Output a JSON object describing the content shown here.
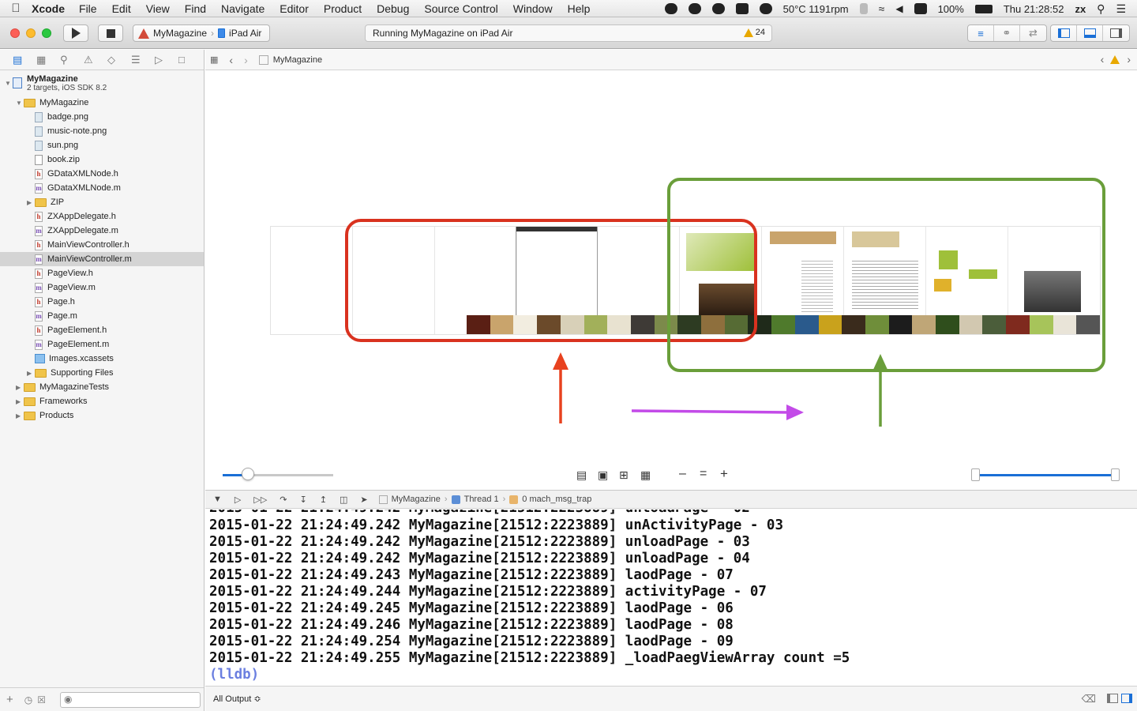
{
  "menubar": {
    "app_name": "Xcode",
    "menus": [
      "File",
      "Edit",
      "View",
      "Find",
      "Navigate",
      "Editor",
      "Product",
      "Debug",
      "Source Control",
      "Window",
      "Help"
    ],
    "cpu_status": "50°C 1191rpm",
    "battery": "100%",
    "clock": "Thu 21:28:52",
    "user": "zx"
  },
  "toolbar": {
    "scheme": "MyMagazine",
    "destination": "iPad Air",
    "activity_text": "Running MyMagazine on iPad Air",
    "warning_count": "24"
  },
  "navigator": {
    "project_name": "MyMagazine",
    "project_subtitle": "2 targets, iOS SDK 8.2",
    "items": [
      {
        "label": "MyMagazine",
        "kind": "folder",
        "level": 1,
        "open": true
      },
      {
        "label": "badge.png",
        "kind": "img",
        "level": 2
      },
      {
        "label": "music-note.png",
        "kind": "img",
        "level": 2
      },
      {
        "label": "sun.png",
        "kind": "img",
        "level": 2
      },
      {
        "label": "book.zip",
        "kind": "zip",
        "level": 2
      },
      {
        "label": "GDataXMLNode.h",
        "kind": "h",
        "level": 2
      },
      {
        "label": "GDataXMLNode.m",
        "kind": "m",
        "level": 2
      },
      {
        "label": "ZIP",
        "kind": "folder",
        "level": 2,
        "open": false
      },
      {
        "label": "ZXAppDelegate.h",
        "kind": "h",
        "level": 2
      },
      {
        "label": "ZXAppDelegate.m",
        "kind": "m",
        "level": 2
      },
      {
        "label": "MainViewController.h",
        "kind": "h",
        "level": 2
      },
      {
        "label": "MainViewController.m",
        "kind": "m",
        "level": 2,
        "selected": true
      },
      {
        "label": "PageView.h",
        "kind": "h",
        "level": 2
      },
      {
        "label": "PageView.m",
        "kind": "m",
        "level": 2
      },
      {
        "label": "Page.h",
        "kind": "h",
        "level": 2
      },
      {
        "label": "Page.m",
        "kind": "m",
        "level": 2
      },
      {
        "label": "PageElement.h",
        "kind": "h",
        "level": 2
      },
      {
        "label": "PageElement.m",
        "kind": "m",
        "level": 2
      },
      {
        "label": "Images.xcassets",
        "kind": "assets",
        "level": 2
      },
      {
        "label": "Supporting Files",
        "kind": "folder",
        "level": 2,
        "open": false
      },
      {
        "label": "MyMagazineTests",
        "kind": "folder",
        "level": 1,
        "open": false
      },
      {
        "label": "Frameworks",
        "kind": "folder",
        "level": 1,
        "open": false
      },
      {
        "label": "Products",
        "kind": "folder",
        "level": 1,
        "open": false
      }
    ]
  },
  "jumpbar": {
    "file": "MyMagazine"
  },
  "debugbar": {
    "crumbs": [
      "MyMagazine",
      "Thread 1",
      "0 mach_msg_trap"
    ]
  },
  "console": {
    "lines": [
      "2015-01-22 21:24:49.242 MyMagazine[21512:2223889] unActivityPage - 03",
      "2015-01-22 21:24:49.242 MyMagazine[21512:2223889] unloadPage - 03",
      "2015-01-22 21:24:49.242 MyMagazine[21512:2223889] unloadPage - 04",
      "2015-01-22 21:24:49.243 MyMagazine[21512:2223889] laodPage - 07",
      "2015-01-22 21:24:49.244 MyMagazine[21512:2223889] activityPage - 07",
      "2015-01-22 21:24:49.245 MyMagazine[21512:2223889] laodPage - 06",
      "2015-01-22 21:24:49.246 MyMagazine[21512:2223889] laodPage - 08",
      "2015-01-22 21:24:49.254 MyMagazine[21512:2223889] laodPage - 09",
      "2015-01-22 21:24:49.255 MyMagazine[21512:2223889] _loadPaegViewArray count =5"
    ],
    "prompt": "(lldb)",
    "output_filter": "All Output ≎"
  },
  "colors": {
    "accent": "#1a6fd6",
    "annotation_red": "#d9321f",
    "annotation_green": "#6a9e3a",
    "annotation_purple": "#c34be8"
  }
}
